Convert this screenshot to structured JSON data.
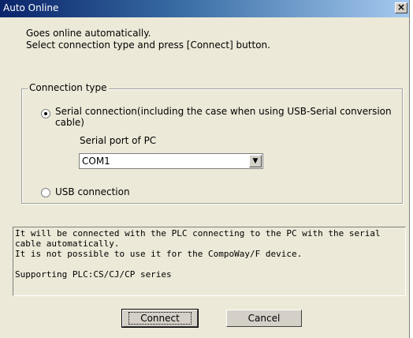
{
  "window": {
    "title": "Auto Online",
    "close_label": "×"
  },
  "intro": {
    "line1": "Goes online automatically.",
    "line2": "Select connection type and press [Connect] button."
  },
  "connection_type": {
    "legend": "Connection type",
    "serial_label": "Serial connection(including the case when using USB-Serial conversion cable)",
    "serial_checked": true,
    "serial_port_label": "Serial port of PC",
    "serial_port_value": "COM1",
    "usb_label": "USB connection",
    "usb_checked": false
  },
  "info": {
    "line1": "It will be connected with the PLC connecting to the PC with the serial cable automatically.",
    "line2": "It is not possible to use it for the CompoWay/F device.",
    "line3": "",
    "line4": "Supporting PLC:CS/CJ/CP series"
  },
  "buttons": {
    "connect": "Connect",
    "cancel": "Cancel"
  }
}
